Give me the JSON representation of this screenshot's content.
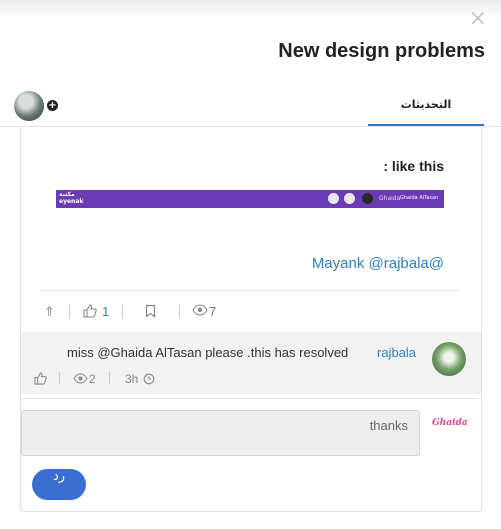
{
  "modal": {
    "close_icon": "×",
    "title": "New design problems",
    "tab": "التحديثات",
    "plus_icon": "+"
  },
  "post": {
    "like_this": ": like this",
    "banner": {
      "logo_top": "مكتبة",
      "logo_bottom": "eyenak",
      "brand": "Ghaida",
      "user": "Ghaida AlTasan",
      "badge": "AR"
    },
    "mention": "Mayank @rajbala@",
    "stats": {
      "up_icon": "⇑",
      "like_icon": "👍",
      "likes": "1",
      "bookmark_icon": "bookmark",
      "view_icon": "eye",
      "views": "7"
    }
  },
  "reply": {
    "user": "rajbala",
    "text": "miss @Ghaida AlTasan please .this has resolved",
    "views": "2",
    "time": "3h"
  },
  "composer": {
    "value": "thanks",
    "logo": "Ghaida",
    "button": "رد"
  },
  "colors": {
    "accent": "#3a6fd1",
    "link": "#2e7fc2",
    "banner": "#6a3bb4"
  }
}
